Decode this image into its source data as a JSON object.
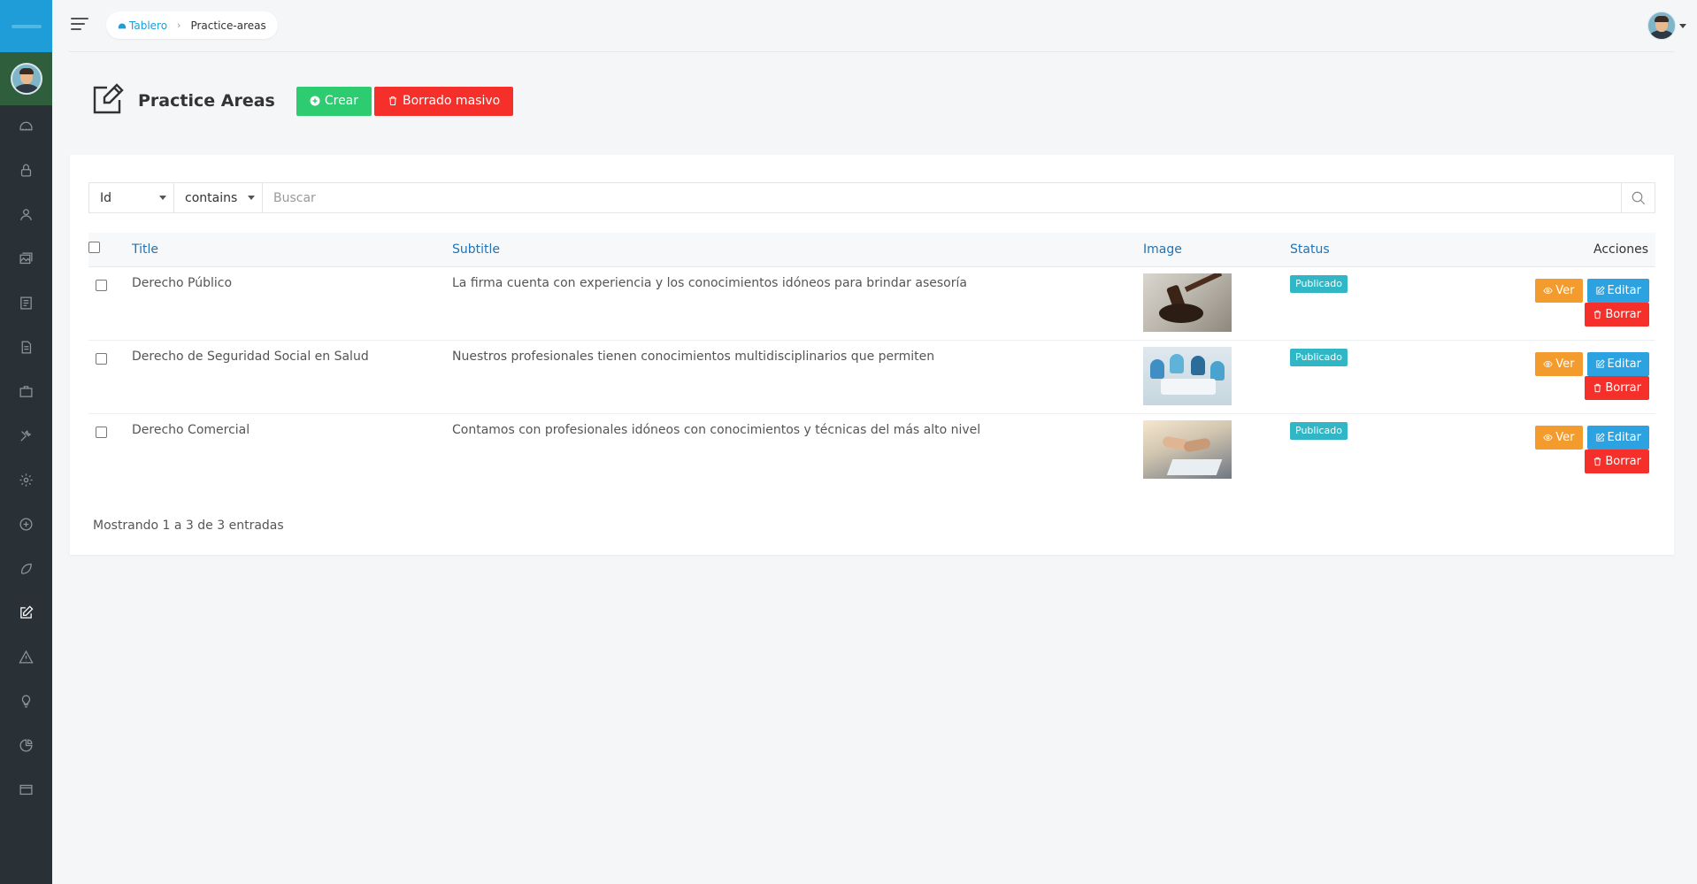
{
  "sidebar": {
    "nav_icons": [
      "dashboard-icon",
      "lock-icon",
      "user-icon",
      "images-icon",
      "file-alt-icon",
      "file-text-icon",
      "briefcase-icon",
      "tools-icon",
      "gear-icon",
      "plus-circle-icon",
      "leaf-icon",
      "edit-icon",
      "warning-icon",
      "lightbulb-icon",
      "pie-chart-icon",
      "window-icon"
    ],
    "active_item": "edit-icon"
  },
  "breadcrumb": {
    "home_label": "Tablero",
    "current_label": "Practice-areas"
  },
  "page": {
    "title": "Practice Areas",
    "create_label": "Crear",
    "bulk_delete_label": "Borrado masivo"
  },
  "filter": {
    "field_value": "Id",
    "operator_value": "contains",
    "search_placeholder": "Buscar"
  },
  "table": {
    "headers": {
      "title": "Title",
      "subtitle": "Subtitle",
      "image": "Image",
      "status": "Status",
      "actions": "Acciones"
    },
    "rows": [
      {
        "title": "Derecho Público",
        "subtitle": "La firma cuenta con experiencia y los conocimientos idóneos para brindar asesoría",
        "image": "gavel-image",
        "status": "Publicado"
      },
      {
        "title": "Derecho de Seguridad Social en Salud",
        "subtitle": "Nuestros profesionales tienen conocimientos multidisciplinarios que permiten",
        "image": "team-meeting-image",
        "status": "Publicado"
      },
      {
        "title": "Derecho Comercial",
        "subtitle": "Contamos con profesionales idóneos con conocimientos y técnicas del más alto nivel",
        "image": "handshake-image",
        "status": "Publicado"
      }
    ],
    "action_labels": {
      "view": "Ver",
      "edit": "Editar",
      "delete": "Borrar"
    }
  },
  "footer": {
    "info": "Mostrando 1 a 3 de 3 entradas"
  },
  "colors": {
    "brand": "#1e9dd8",
    "sidebar_bg": "#2a3136",
    "create": "#2ecc71",
    "danger": "#f5302b",
    "view": "#f39c2d",
    "edit": "#2ca3e0",
    "badge": "#31b6c6"
  }
}
